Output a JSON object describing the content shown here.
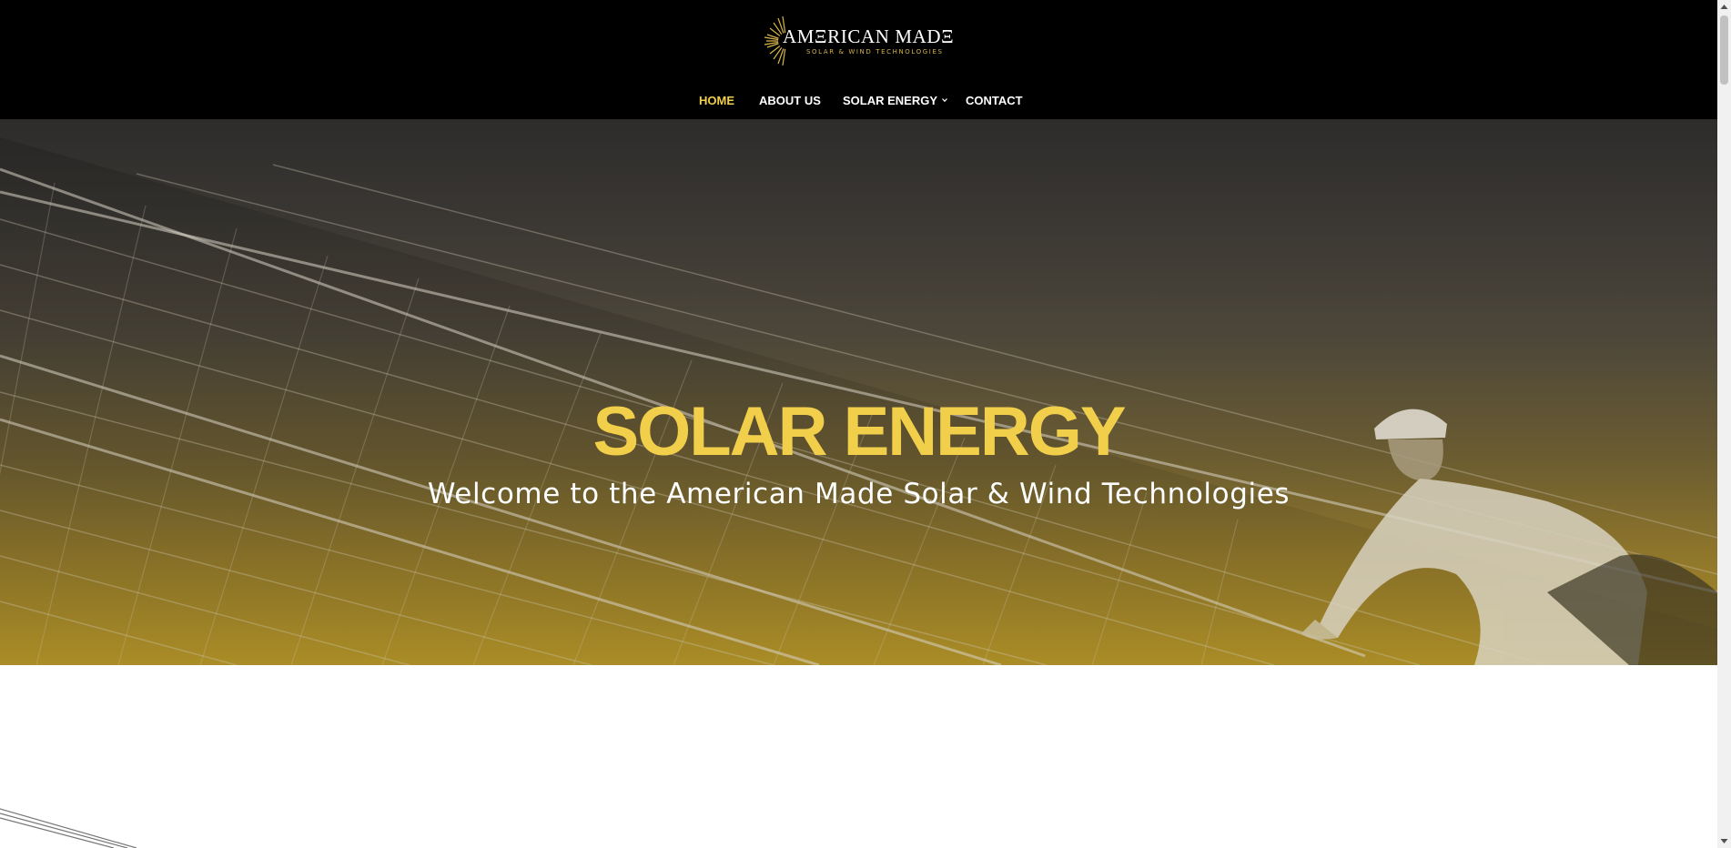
{
  "header": {
    "logo": {
      "main_text": "AMΞRICAN  MADΞ",
      "sub_text": "SOLAR & WIND TECHNOLOGIES",
      "icon": "sunburst-icon",
      "accent_color": "#d7b546"
    },
    "nav": {
      "items": [
        {
          "label": "HOME",
          "active": true
        },
        {
          "label": "ABOUT US",
          "active": false
        },
        {
          "label": "SOLAR ENERGY",
          "active": false,
          "has_dropdown": true
        },
        {
          "label": "CONTACT",
          "active": false
        }
      ],
      "active_color": "#f2cf4a",
      "dropdown_icon": "chevron-down-icon"
    }
  },
  "hero": {
    "title": "SOLAR ENERGY",
    "subtitle": "Welcome to the American Made Solar & Wind Technologies",
    "title_color": "#f2cf4a",
    "background": "solar-panels-with-worker-image"
  },
  "colors": {
    "header_bg": "#000000",
    "accent": "#f2cf4a",
    "gradient_bottom": "#b39428"
  }
}
